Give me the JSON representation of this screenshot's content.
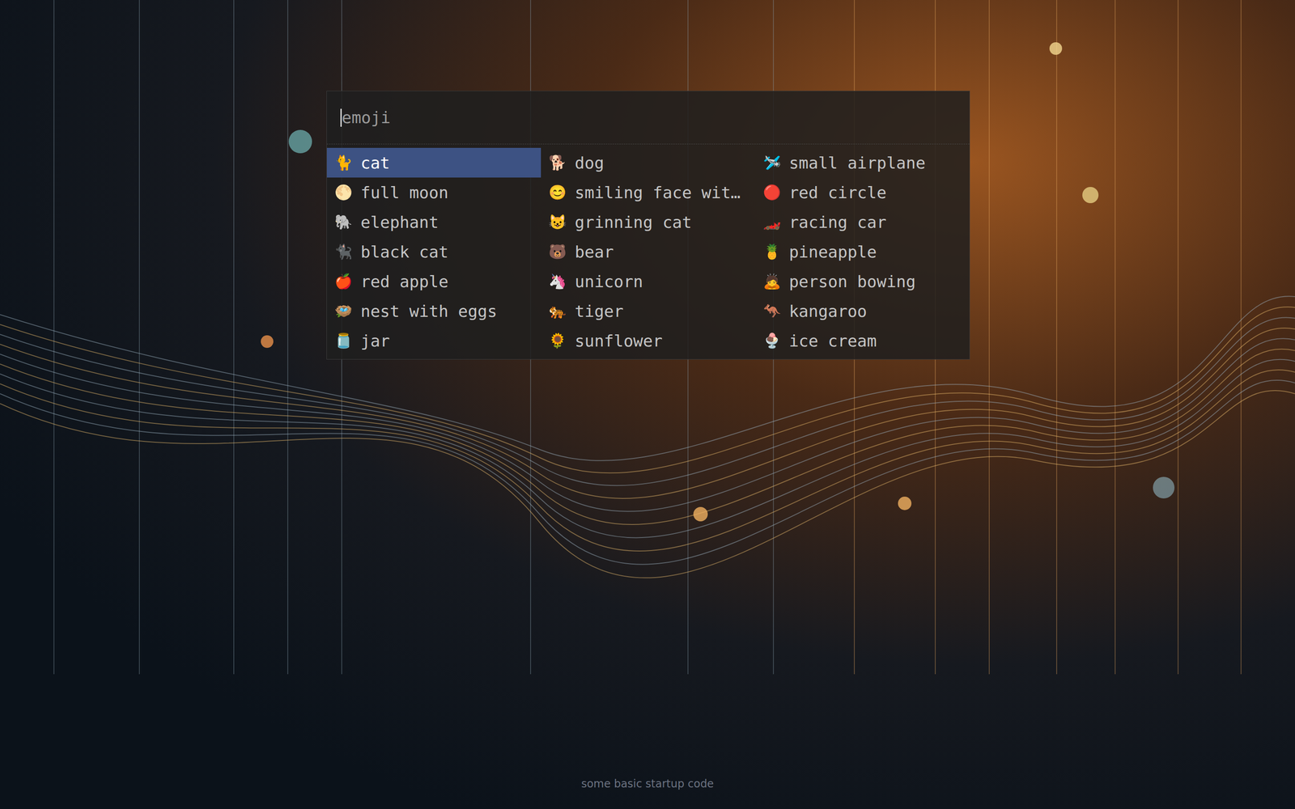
{
  "search": {
    "placeholder": "emoji"
  },
  "items": [
    {
      "icon": "🐈",
      "label": "cat",
      "selected": true
    },
    {
      "icon": "🐕",
      "label": "dog",
      "selected": false
    },
    {
      "icon": "🛩️",
      "label": "small airplane",
      "selected": false
    },
    {
      "icon": "🌕",
      "label": "full moon",
      "selected": false
    },
    {
      "icon": "😊",
      "label": "smiling face wit…",
      "selected": false
    },
    {
      "icon": "🔴",
      "label": "red circle",
      "selected": false
    },
    {
      "icon": "🐘",
      "label": "elephant",
      "selected": false
    },
    {
      "icon": "😺",
      "label": "grinning cat",
      "selected": false
    },
    {
      "icon": "🏎️",
      "label": "racing car",
      "selected": false
    },
    {
      "icon": "🐈‍⬛",
      "label": "black cat",
      "selected": false
    },
    {
      "icon": "🐻",
      "label": "bear",
      "selected": false
    },
    {
      "icon": "🍍",
      "label": "pineapple",
      "selected": false
    },
    {
      "icon": "🍎",
      "label": "red apple",
      "selected": false
    },
    {
      "icon": "🦄",
      "label": "unicorn",
      "selected": false
    },
    {
      "icon": "🙇",
      "label": "person bowing",
      "selected": false
    },
    {
      "icon": "🪺",
      "label": "nest with eggs",
      "selected": false
    },
    {
      "icon": "🐅",
      "label": "tiger",
      "selected": false
    },
    {
      "icon": "🦘",
      "label": "kangaroo",
      "selected": false
    },
    {
      "icon": "🫙",
      "label": "jar",
      "selected": false
    },
    {
      "icon": "🌻",
      "label": "sunflower",
      "selected": false
    },
    {
      "icon": "🍨",
      "label": "ice cream",
      "selected": false
    }
  ],
  "footer": "some basic startup code"
}
